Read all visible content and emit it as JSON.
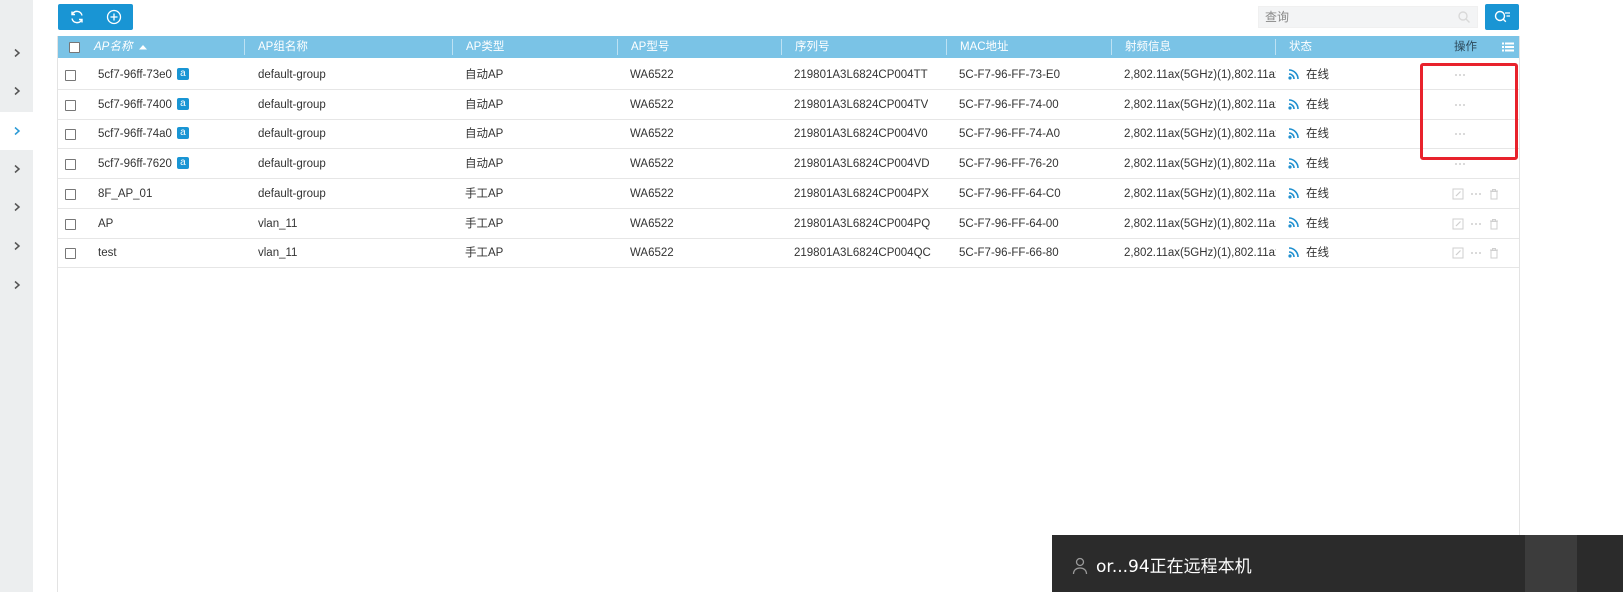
{
  "sidebar": {
    "items": [
      {
        "icon": "chevron-right-icon",
        "active": false
      },
      {
        "icon": "chevron-right-icon",
        "active": false
      },
      {
        "icon": "chevron-right-icon",
        "active": true
      },
      {
        "icon": "chevron-right-icon",
        "active": false
      },
      {
        "icon": "chevron-right-icon",
        "active": false
      },
      {
        "icon": "chevron-right-icon",
        "active": false
      },
      {
        "icon": "chevron-right-icon",
        "active": false
      }
    ]
  },
  "toolbar": {
    "refresh_icon": "refresh-icon",
    "add_icon": "add-circle-icon",
    "accent_color": "#1995d4"
  },
  "search": {
    "placeholder": "查询",
    "advanced_icon": "advanced-search-icon"
  },
  "table": {
    "header_color": "#7ac3e6",
    "columns": {
      "name": "AP名称",
      "group": "AP组名称",
      "type": "AP类型",
      "model": "AP型号",
      "serial": "序列号",
      "mac": "MAC地址",
      "radio": "射频信息",
      "status": "状态",
      "ops": "操作"
    },
    "sort_icon": "sort-ascending-icon",
    "columns_menu_icon": "list-icon",
    "rows": [
      {
        "name": "5cf7-96ff-73e0",
        "auto_badge": "a",
        "group": "default-group",
        "type": "自动AP",
        "model": "WA6522",
        "serial": "219801A3L6824CP004TT",
        "mac": "5C-F7-96-FF-73-E0",
        "radio": "2,802.11ax(5GHz)(1),802.11ax...",
        "status": "在线",
        "ops": [
          "more"
        ]
      },
      {
        "name": "5cf7-96ff-7400",
        "auto_badge": "a",
        "group": "default-group",
        "type": "自动AP",
        "model": "WA6522",
        "serial": "219801A3L6824CP004TV",
        "mac": "5C-F7-96-FF-74-00",
        "radio": "2,802.11ax(5GHz)(1),802.11ax...",
        "status": "在线",
        "ops": [
          "more"
        ]
      },
      {
        "name": "5cf7-96ff-74a0",
        "auto_badge": "a",
        "group": "default-group",
        "type": "自动AP",
        "model": "WA6522",
        "serial": "219801A3L6824CP004V0",
        "mac": "5C-F7-96-FF-74-A0",
        "radio": "2,802.11ax(5GHz)(1),802.11ax...",
        "status": "在线",
        "ops": [
          "more"
        ]
      },
      {
        "name": "5cf7-96ff-7620",
        "auto_badge": "a",
        "group": "default-group",
        "type": "自动AP",
        "model": "WA6522",
        "serial": "219801A3L6824CP004VD",
        "mac": "5C-F7-96-FF-76-20",
        "radio": "2,802.11ax(5GHz)(1),802.11ax...",
        "status": "在线",
        "ops": [
          "more"
        ]
      },
      {
        "name": "8F_AP_01",
        "auto_badge": "",
        "group": "default-group",
        "type": "手工AP",
        "model": "WA6522",
        "serial": "219801A3L6824CP004PX",
        "mac": "5C-F7-96-FF-64-C0",
        "radio": "2,802.11ax(5GHz)(1),802.11ax...",
        "status": "在线",
        "ops": [
          "edit",
          "more",
          "delete"
        ]
      },
      {
        "name": "AP",
        "auto_badge": "",
        "group": "vlan_11",
        "type": "手工AP",
        "model": "WA6522",
        "serial": "219801A3L6824CP004PQ",
        "mac": "5C-F7-96-FF-64-00",
        "radio": "2,802.11ax(5GHz)(1),802.11ax...",
        "status": "在线",
        "ops": [
          "edit",
          "more",
          "delete"
        ]
      },
      {
        "name": "test",
        "auto_badge": "",
        "group": "vlan_11",
        "type": "手工AP",
        "model": "WA6522",
        "serial": "219801A3L6824CP004QC",
        "mac": "5C-F7-96-FF-66-80",
        "radio": "2,802.11ax(5GHz)(1),802.11ax...",
        "status": "在线",
        "ops": [
          "edit",
          "more",
          "delete"
        ]
      }
    ]
  },
  "highlight": {
    "color": "#e8222c"
  },
  "remote_notice": {
    "text": "or...94正在远程本机",
    "icon": "user-icon"
  }
}
